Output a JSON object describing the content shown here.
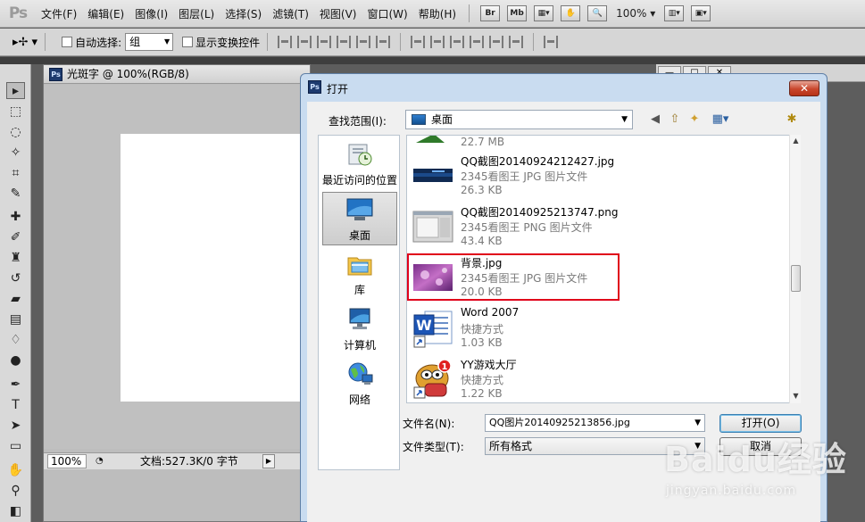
{
  "app": {
    "logo": "Ps",
    "menus": [
      "文件(F)",
      "编辑(E)",
      "图像(I)",
      "图层(L)",
      "选择(S)",
      "滤镜(T)",
      "视图(V)",
      "窗口(W)",
      "帮助(H)"
    ],
    "menubar_buttons": [
      "Br",
      "Mb"
    ],
    "zoom": "100%"
  },
  "options": {
    "auto_select_label": "自动选择:",
    "auto_select_value": "组",
    "show_transform_label": "显示变换控件"
  },
  "document": {
    "title": "光斑字 @ 100%(RGB/8)",
    "zoom": "100%",
    "info": "文档:527.3K/0 字节"
  },
  "dialog": {
    "title": "打开",
    "look_in_label": "查找范围(I):",
    "look_in_value": "桌面",
    "places": [
      {
        "label": "最近访问的位置",
        "icon": "recent-places-icon"
      },
      {
        "label": "桌面",
        "icon": "desktop-icon"
      },
      {
        "label": "库",
        "icon": "library-icon"
      },
      {
        "label": "计算机",
        "icon": "computer-icon"
      },
      {
        "label": "网络",
        "icon": "network-icon"
      }
    ],
    "files": [
      {
        "name": "",
        "type": "",
        "size": "22.7 MB"
      },
      {
        "name": "QQ截图20140924212427.jpg",
        "type": "2345看图王 JPG 图片文件",
        "size": "26.3 KB"
      },
      {
        "name": "QQ截图20140925213747.png",
        "type": "2345看图王 PNG 图片文件",
        "size": "43.4 KB"
      },
      {
        "name": "背景.jpg",
        "type": "2345看图王 JPG 图片文件",
        "size": "20.0 KB"
      },
      {
        "name": "Word 2007",
        "type": "快捷方式",
        "size": "1.03 KB"
      },
      {
        "name": "YY游戏大厅",
        "type": "快捷方式",
        "size": "1.22 KB"
      }
    ],
    "filename_label": "文件名(N):",
    "filename_value": "QQ图片20140925213856.jpg",
    "filetype_label": "文件类型(T):",
    "filetype_value": "所有格式",
    "open_button": "打开(O)",
    "cancel_button": "取消",
    "badge_count": "1"
  },
  "watermark": {
    "logo": "Baidu经验",
    "url": "jingyan.baidu.com"
  },
  "colors": {
    "highlight": "#e0001a",
    "dialog_frame": "#c9dcf0",
    "ps_background": "#5d5d5d"
  }
}
